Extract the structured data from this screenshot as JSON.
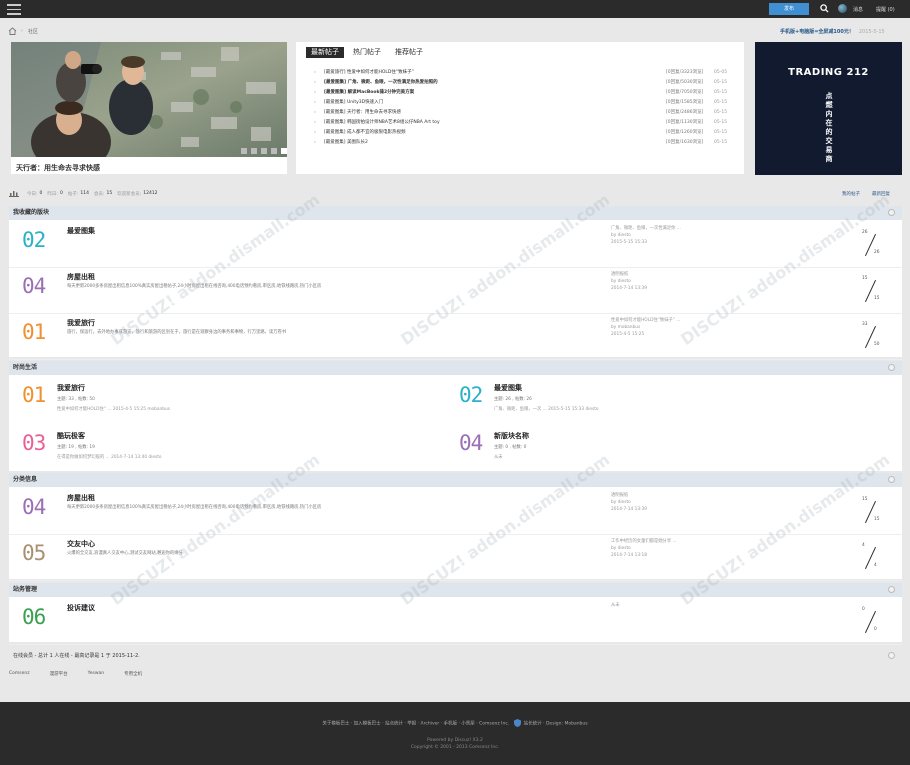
{
  "topbar": {
    "publish": "发布",
    "message": "消息",
    "remind": "提醒",
    "remind_count": "(0)"
  },
  "breadcrumb": {
    "current": "社区"
  },
  "notice": {
    "text": "手机版+电脑版=全屏减100元！",
    "date": "2015-5-15"
  },
  "slider": {
    "caption": "天行者：用生命去寻求快感",
    "active_dot": 5,
    "dot_count": 5
  },
  "posts": {
    "tabs": [
      "最新帖子",
      "热门帖子",
      "推荐帖子"
    ],
    "active_tab": 0,
    "items": [
      {
        "title": "[最爱旅行] 性爱中如何才能HOLD住“致妹子”",
        "count": "[0回复/3323浏览]",
        "date": "05-05",
        "bold": false
      },
      {
        "title": "[最爱图集] 广角、微距、鱼眼，一次性满足你热爱拍照的",
        "count": "[0回复/5030浏览]",
        "date": "05-15",
        "bold": true
      },
      {
        "title": "[最爱图集] 解读MacBook操2分钟完美方案",
        "count": "[0回复/7050浏览]",
        "date": "05-15",
        "bold": true
      },
      {
        "title": "[最爱图集] Unity3D快速入门",
        "count": "[0回复/1585浏览]",
        "date": "05-15",
        "bold": false
      },
      {
        "title": "[最爱图集] 天行者：用生命去寻求快感",
        "count": "[0回复/2486浏览]",
        "date": "05-15",
        "bold": false
      },
      {
        "title": "[最爱图集] 韩国街拍设计师NBA艺术8组公仔NBA Art toy",
        "count": "[0回复/1130浏览]",
        "date": "05-15",
        "bold": false
      },
      {
        "title": "[最爱图集] 成人都不宜的极限电影热视频",
        "count": "[0回复/1260浏览]",
        "date": "05-15",
        "bold": false
      },
      {
        "title": "[最爱图集] 美图队长2",
        "count": "[0回复/1630浏览]",
        "date": "05-15",
        "bold": false
      }
    ]
  },
  "ad": {
    "logo": "TRADING 212",
    "slogan": "点燃内在的交易商"
  },
  "stats": {
    "today_label": "今日:",
    "today": "0",
    "yesterday_label": "昨日:",
    "yesterday": "0",
    "posts_label": "帖子:",
    "posts": "114",
    "members_label": "会员:",
    "members": "15",
    "newest_label": "欢迎新会员:",
    "newest": "12412",
    "my_posts": "我的帖子",
    "latest_reply": "最新回复"
  },
  "sections": [
    {
      "title": "我收藏的版块"
    },
    {
      "title": "时尚生活"
    },
    {
      "title": "分类信息"
    },
    {
      "title": "站务管理"
    }
  ],
  "fav_forums": [
    {
      "num": "02",
      "color": "#2ab0c8",
      "name": "最爱图集",
      "desc": "",
      "last_title": "广角、微距、鱼眼，一次性满足你 ...",
      "last_by": "by diesto",
      "last_time": "2015-5-15 15:33",
      "top": "26",
      "bottom": "26"
    },
    {
      "num": "04",
      "color": "#9b6fb5",
      "name": "房屋出租",
      "desc": "每天更新2000多条房屋出租信息100%真实房屋出租帖子,24小时房屋出租在线咨询,400电话预约看房,审区房,地铁线路房,热门小区房",
      "last_title": "透明报纸",
      "last_by": "by diesto",
      "last_time": "2014-7-14 13:39",
      "top": "15",
      "bottom": "15"
    },
    {
      "num": "01",
      "color": "#f09030",
      "name": "我爱旅行",
      "desc": "旅行，保运行。去外地办事或游览，旅行和旅游的区别在于，旅行是在观察身边的事务和事物，行万里路，读万卷书",
      "last_title": "性爱中如何才能HOLD住“致妹子” ...",
      "last_by": "by mobanbus",
      "last_time": "2015-4-5 15:25",
      "top": "33",
      "bottom": "50"
    }
  ],
  "life_forums": [
    {
      "num": "01",
      "color": "#f09030",
      "name": "我爱旅行",
      "meta": "主题: 33 , 帖数: 50",
      "sub": "性爱中如何才能HOLD住“ ... 2015-4-5 15:25 mobanbus"
    },
    {
      "num": "02",
      "color": "#2ab0c8",
      "name": "最爱图集",
      "meta": "主题: 26 , 帖数: 26",
      "sub": "广角、微距、鱼眼，一次 ... 2015-5-15 15:33 diesto"
    },
    {
      "num": "03",
      "color": "#e8609a",
      "name": "酷玩极客",
      "meta": "主题: 19 , 帖数: 19",
      "sub": "在得是你做如何梦幻般的 ... 2014-7-14 13:40 diesto"
    },
    {
      "num": "04",
      "color": "#9b6fb5",
      "name": "新版块名称",
      "meta": "主题: 0 , 帖数: 0",
      "sub": "从未"
    }
  ],
  "info_forums": [
    {
      "num": "04",
      "color": "#9b6fb5",
      "name": "房屋出租",
      "desc": "每天更新2000多条房屋出租信息100%真实房屋出租帖子,24小时房屋出租在线咨询,400电话预约看房,审区房,地铁线路房,热门小区房",
      "last_title": "透明报纸",
      "last_by": "by diesto",
      "last_time": "2014-7-14 13:39",
      "top": "15",
      "bottom": "15"
    },
    {
      "num": "05",
      "color": "#a89070",
      "name": "交友中心",
      "desc": "火爆的全交友,浪漫真人交友中心,测试交友网站,邂逅你的缘分",
      "last_title": "工作中经历的女童们都是她分享 ...",
      "last_by": "by diesto",
      "last_time": "2014-7-14 13:18",
      "top": "4",
      "bottom": "4"
    }
  ],
  "admin_forums": [
    {
      "num": "06",
      "color": "#3aa050",
      "name": "投诉建议",
      "desc": "",
      "last_title": "从未",
      "last_by": "",
      "last_time": "",
      "top": "0",
      "bottom": "0"
    }
  ],
  "online": {
    "text": "在线会员 - 总计 1 人在线 - 最高记录是 1 于 2015-11-2."
  },
  "links": [
    "Comsenz",
    "漫游平台",
    "Yeswan",
    "专用全机"
  ],
  "footer": {
    "links": "关于模板巴士 · 加入模板巴士 · 站点统计 · 举报 · Archiver · 手机版 · 小黑屋 · Comsenz Inc.",
    "links_right": "站长统计 · Design: Mobanbus",
    "powered": "Powered by Discuz! X3.2",
    "copyright": "Copyright © 2001 - 2013 Comsenz Inc."
  },
  "colors": {
    "topbar": "#2b2b2b",
    "accent": "#3f8fd2",
    "section": "#dfe5ec"
  }
}
